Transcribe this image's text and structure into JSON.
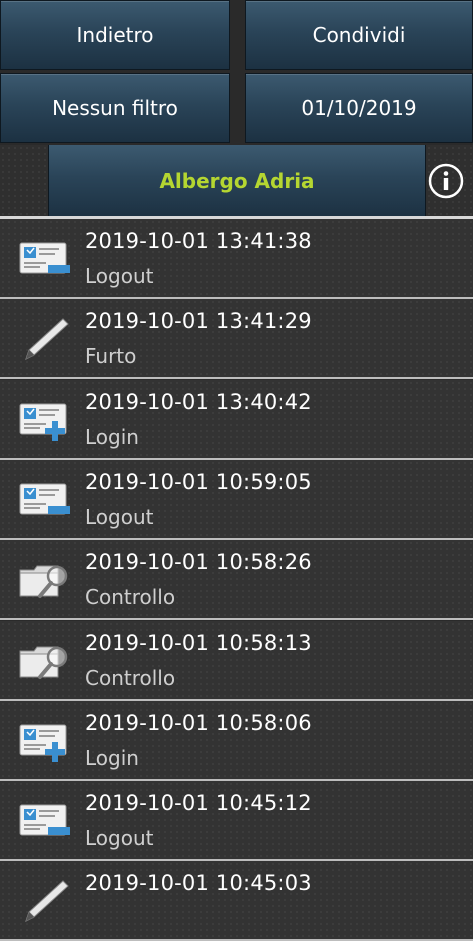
{
  "toolbar": {
    "back_label": "Indietro",
    "share_label": "Condividi",
    "filter_label": "Nessun filtro",
    "date_label": "01/10/2019"
  },
  "header": {
    "hotel_name": "Albergo Adria",
    "info_icon": "info-icon",
    "title_color": "#b5d631"
  },
  "events": [
    {
      "timestamp": "2019-10-01 13:41:38",
      "type": "Logout",
      "icon": "id-card-icon"
    },
    {
      "timestamp": "2019-10-01 13:41:29",
      "type": "Furto",
      "icon": "pen-icon"
    },
    {
      "timestamp": "2019-10-01 13:40:42",
      "type": "Login",
      "icon": "id-card-plus-icon"
    },
    {
      "timestamp": "2019-10-01 10:59:05",
      "type": "Logout",
      "icon": "id-card-icon"
    },
    {
      "timestamp": "2019-10-01 10:58:26",
      "type": "Controllo",
      "icon": "folder-search-icon"
    },
    {
      "timestamp": "2019-10-01 10:58:13",
      "type": "Controllo",
      "icon": "folder-search-icon"
    },
    {
      "timestamp": "2019-10-01 10:58:06",
      "type": "Login",
      "icon": "id-card-plus-icon"
    },
    {
      "timestamp": "2019-10-01 10:45:12",
      "type": "Logout",
      "icon": "id-card-icon"
    },
    {
      "timestamp": "2019-10-01 10:45:03",
      "type": "",
      "icon": "pen-icon"
    }
  ]
}
